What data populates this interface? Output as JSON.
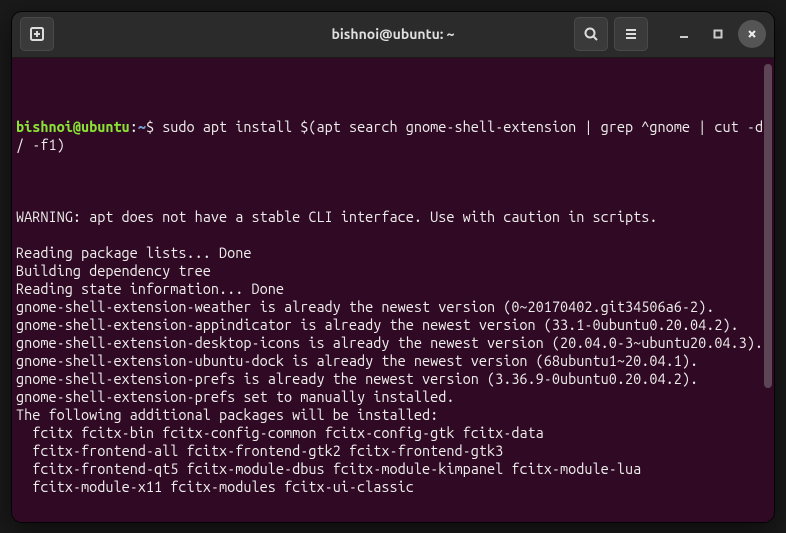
{
  "title": "bishnoi@ubuntu: ~",
  "prompt": {
    "user": "bishnoi@ubuntu",
    "path": "~",
    "command": "sudo apt install $(apt search gnome-shell-extension | grep ^gnome | cut -d / -f1)"
  },
  "output_lines": [
    "",
    "WARNING: apt does not have a stable CLI interface. Use with caution in scripts.",
    "",
    "Reading package lists... Done",
    "Building dependency tree",
    "Reading state information... Done",
    "gnome-shell-extension-weather is already the newest version (0~20170402.git34506a6-2).",
    "gnome-shell-extension-appindicator is already the newest version (33.1-0ubuntu0.20.04.2).",
    "gnome-shell-extension-desktop-icons is already the newest version (20.04.0-3~ubuntu20.04.3).",
    "gnome-shell-extension-ubuntu-dock is already the newest version (68ubuntu1~20.04.1).",
    "gnome-shell-extension-prefs is already the newest version (3.36.9-0ubuntu0.20.04.2).",
    "gnome-shell-extension-prefs set to manually installed.",
    "The following additional packages will be installed:",
    "  fcitx fcitx-bin fcitx-config-common fcitx-config-gtk fcitx-data",
    "  fcitx-frontend-all fcitx-frontend-gtk2 fcitx-frontend-gtk3",
    "  fcitx-frontend-qt5 fcitx-module-dbus fcitx-module-kimpanel fcitx-module-lua",
    "  fcitx-module-x11 fcitx-modules fcitx-ui-classic"
  ]
}
